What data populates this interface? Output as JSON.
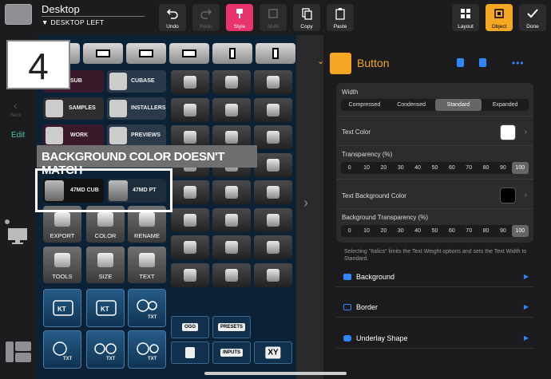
{
  "window": {
    "title": "Desktop",
    "subtitle": "DESKTOP LEFT"
  },
  "toolbar": {
    "undo": "Undo",
    "redo": "Redo",
    "style": "Style",
    "multi": "Multi",
    "copy": "Copy",
    "paste": "Paste",
    "layout": "Layout",
    "object": "Object",
    "done": "Done"
  },
  "sidebar": {
    "back": "Back",
    "edit": "Edit"
  },
  "overlay": {
    "number": "4",
    "banner": "BACKGROUND COLOR DOESN'T MATCH"
  },
  "canvas": {
    "folders": [
      {
        "left": "SUB",
        "right": "CUBASE"
      },
      {
        "left": "SAMPLES",
        "right": "INSTALLERS"
      },
      {
        "left": "WORK",
        "right": "PREVIEWS"
      }
    ],
    "highlighted": [
      "47MD CUB",
      "47MD PT"
    ],
    "tools_row1": [
      "EXPORT",
      "COLOR",
      "RENAME"
    ],
    "tools_row2": [
      "TOOLS",
      "SIZE",
      "TEXT"
    ],
    "blue_labels": [
      "TXT",
      "TXT",
      "TXT",
      "TXT"
    ],
    "small_buttons": [
      "OGG",
      "PRESETS",
      "INPUTS",
      "XY"
    ]
  },
  "inspector": {
    "object_name": "Button",
    "accent": "#f5a623",
    "width_label": "Width",
    "width_options": [
      "Compressed",
      "Condensed",
      "Standard",
      "Expanded"
    ],
    "width_selected": "Standard",
    "text_color_label": "Text Color",
    "text_color": "#ffffff",
    "transparency_label": "Transparency (%)",
    "transparency_options": [
      "0",
      "10",
      "20",
      "30",
      "40",
      "50",
      "60",
      "70",
      "80",
      "90",
      "100"
    ],
    "transparency_selected": "100",
    "text_bg_label": "Text Background Color",
    "text_bg_color": "#000000",
    "bg_transparency_label": "Background Transparency (%)",
    "bg_transparency_selected": "100",
    "note": "Selecting \"Italics\" limits the Text Weight options and sets the Text Width to Standard.",
    "nav": [
      {
        "label": "Background",
        "icon_color": "#2f86ff"
      },
      {
        "label": "Border",
        "icon_color": "#2f86ff"
      },
      {
        "label": "Underlay Shape",
        "icon_color": "#2f86ff"
      }
    ]
  }
}
